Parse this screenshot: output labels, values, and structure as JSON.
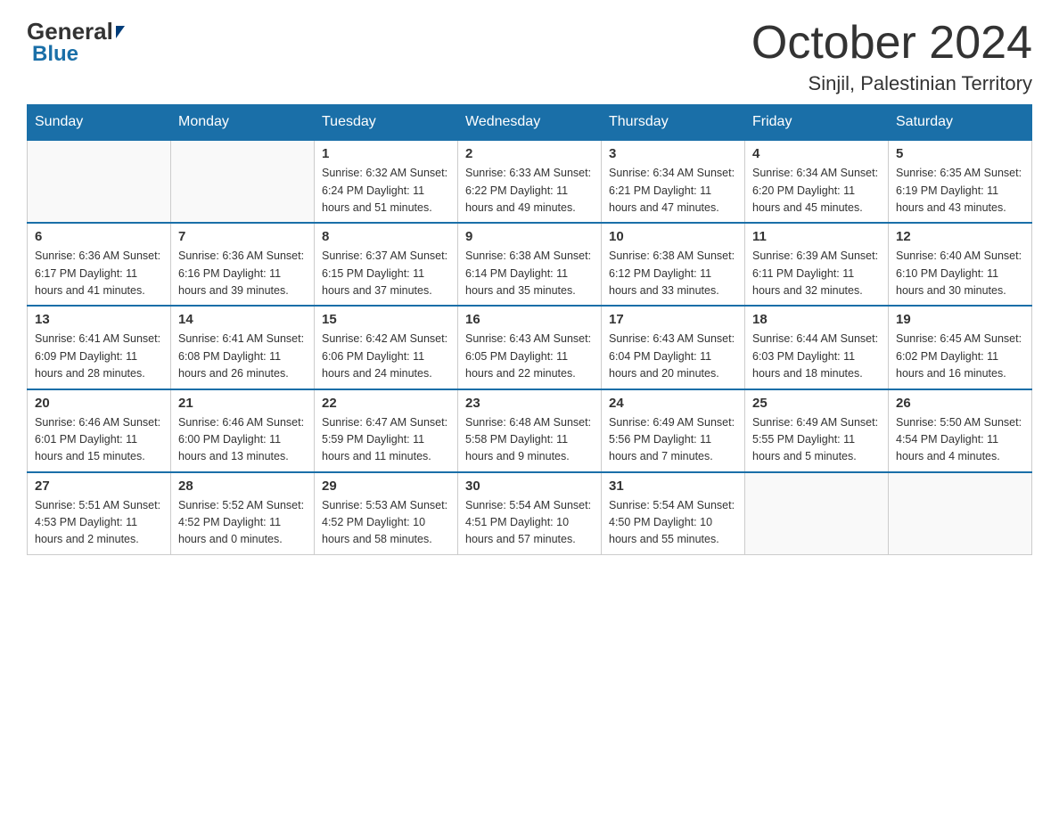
{
  "logo": {
    "general": "General",
    "blue": "Blue"
  },
  "title": {
    "month_year": "October 2024",
    "location": "Sinjil, Palestinian Territory"
  },
  "weekdays": [
    "Sunday",
    "Monday",
    "Tuesday",
    "Wednesday",
    "Thursday",
    "Friday",
    "Saturday"
  ],
  "weeks": [
    [
      {
        "day": "",
        "info": ""
      },
      {
        "day": "",
        "info": ""
      },
      {
        "day": "1",
        "info": "Sunrise: 6:32 AM\nSunset: 6:24 PM\nDaylight: 11 hours\nand 51 minutes."
      },
      {
        "day": "2",
        "info": "Sunrise: 6:33 AM\nSunset: 6:22 PM\nDaylight: 11 hours\nand 49 minutes."
      },
      {
        "day": "3",
        "info": "Sunrise: 6:34 AM\nSunset: 6:21 PM\nDaylight: 11 hours\nand 47 minutes."
      },
      {
        "day": "4",
        "info": "Sunrise: 6:34 AM\nSunset: 6:20 PM\nDaylight: 11 hours\nand 45 minutes."
      },
      {
        "day": "5",
        "info": "Sunrise: 6:35 AM\nSunset: 6:19 PM\nDaylight: 11 hours\nand 43 minutes."
      }
    ],
    [
      {
        "day": "6",
        "info": "Sunrise: 6:36 AM\nSunset: 6:17 PM\nDaylight: 11 hours\nand 41 minutes."
      },
      {
        "day": "7",
        "info": "Sunrise: 6:36 AM\nSunset: 6:16 PM\nDaylight: 11 hours\nand 39 minutes."
      },
      {
        "day": "8",
        "info": "Sunrise: 6:37 AM\nSunset: 6:15 PM\nDaylight: 11 hours\nand 37 minutes."
      },
      {
        "day": "9",
        "info": "Sunrise: 6:38 AM\nSunset: 6:14 PM\nDaylight: 11 hours\nand 35 minutes."
      },
      {
        "day": "10",
        "info": "Sunrise: 6:38 AM\nSunset: 6:12 PM\nDaylight: 11 hours\nand 33 minutes."
      },
      {
        "day": "11",
        "info": "Sunrise: 6:39 AM\nSunset: 6:11 PM\nDaylight: 11 hours\nand 32 minutes."
      },
      {
        "day": "12",
        "info": "Sunrise: 6:40 AM\nSunset: 6:10 PM\nDaylight: 11 hours\nand 30 minutes."
      }
    ],
    [
      {
        "day": "13",
        "info": "Sunrise: 6:41 AM\nSunset: 6:09 PM\nDaylight: 11 hours\nand 28 minutes."
      },
      {
        "day": "14",
        "info": "Sunrise: 6:41 AM\nSunset: 6:08 PM\nDaylight: 11 hours\nand 26 minutes."
      },
      {
        "day": "15",
        "info": "Sunrise: 6:42 AM\nSunset: 6:06 PM\nDaylight: 11 hours\nand 24 minutes."
      },
      {
        "day": "16",
        "info": "Sunrise: 6:43 AM\nSunset: 6:05 PM\nDaylight: 11 hours\nand 22 minutes."
      },
      {
        "day": "17",
        "info": "Sunrise: 6:43 AM\nSunset: 6:04 PM\nDaylight: 11 hours\nand 20 minutes."
      },
      {
        "day": "18",
        "info": "Sunrise: 6:44 AM\nSunset: 6:03 PM\nDaylight: 11 hours\nand 18 minutes."
      },
      {
        "day": "19",
        "info": "Sunrise: 6:45 AM\nSunset: 6:02 PM\nDaylight: 11 hours\nand 16 minutes."
      }
    ],
    [
      {
        "day": "20",
        "info": "Sunrise: 6:46 AM\nSunset: 6:01 PM\nDaylight: 11 hours\nand 15 minutes."
      },
      {
        "day": "21",
        "info": "Sunrise: 6:46 AM\nSunset: 6:00 PM\nDaylight: 11 hours\nand 13 minutes."
      },
      {
        "day": "22",
        "info": "Sunrise: 6:47 AM\nSunset: 5:59 PM\nDaylight: 11 hours\nand 11 minutes."
      },
      {
        "day": "23",
        "info": "Sunrise: 6:48 AM\nSunset: 5:58 PM\nDaylight: 11 hours\nand 9 minutes."
      },
      {
        "day": "24",
        "info": "Sunrise: 6:49 AM\nSunset: 5:56 PM\nDaylight: 11 hours\nand 7 minutes."
      },
      {
        "day": "25",
        "info": "Sunrise: 6:49 AM\nSunset: 5:55 PM\nDaylight: 11 hours\nand 5 minutes."
      },
      {
        "day": "26",
        "info": "Sunrise: 5:50 AM\nSunset: 4:54 PM\nDaylight: 11 hours\nand 4 minutes."
      }
    ],
    [
      {
        "day": "27",
        "info": "Sunrise: 5:51 AM\nSunset: 4:53 PM\nDaylight: 11 hours\nand 2 minutes."
      },
      {
        "day": "28",
        "info": "Sunrise: 5:52 AM\nSunset: 4:52 PM\nDaylight: 11 hours\nand 0 minutes."
      },
      {
        "day": "29",
        "info": "Sunrise: 5:53 AM\nSunset: 4:52 PM\nDaylight: 10 hours\nand 58 minutes."
      },
      {
        "day": "30",
        "info": "Sunrise: 5:54 AM\nSunset: 4:51 PM\nDaylight: 10 hours\nand 57 minutes."
      },
      {
        "day": "31",
        "info": "Sunrise: 5:54 AM\nSunset: 4:50 PM\nDaylight: 10 hours\nand 55 minutes."
      },
      {
        "day": "",
        "info": ""
      },
      {
        "day": "",
        "info": ""
      }
    ]
  ]
}
